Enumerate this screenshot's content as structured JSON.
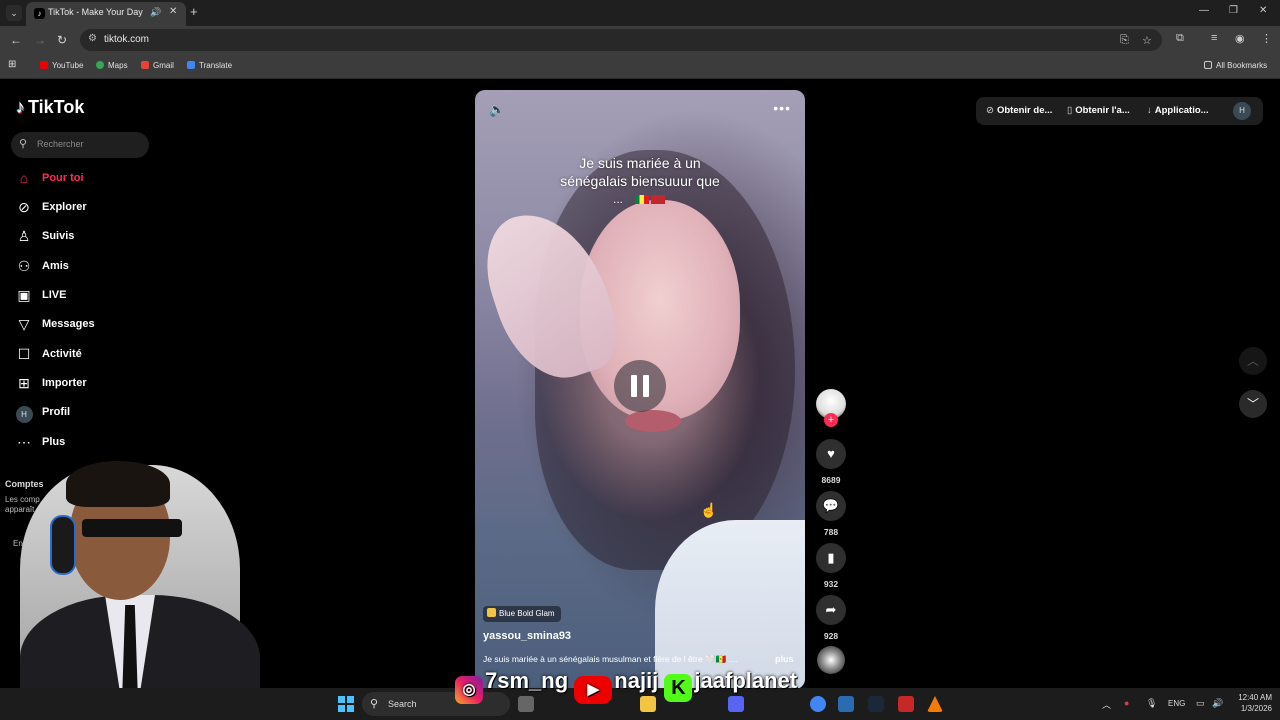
{
  "browser": {
    "tab_title": "TikTok - Make Your Day",
    "url": "tiktok.com",
    "bookmarks": [
      "YouTube",
      "Maps",
      "Gmail",
      "Translate"
    ],
    "all_bookmarks": "All Bookmarks"
  },
  "tiktok": {
    "logo": "TikTok",
    "search_placeholder": "Rechercher",
    "nav": [
      {
        "label": "Pour toi",
        "icon": "home-icon"
      },
      {
        "label": "Explorer",
        "icon": "compass-icon"
      },
      {
        "label": "Suivis",
        "icon": "following-icon"
      },
      {
        "label": "Amis",
        "icon": "friends-icon"
      },
      {
        "label": "LIVE",
        "icon": "live-icon"
      },
      {
        "label": "Messages",
        "icon": "messages-icon"
      },
      {
        "label": "Activité",
        "icon": "activity-icon"
      },
      {
        "label": "Importer",
        "icon": "upload-icon"
      },
      {
        "label": "Profil",
        "icon": "profile-avatar"
      },
      {
        "label": "Plus",
        "icon": "more-icon"
      }
    ],
    "profile_initial": "H",
    "side_partial": [
      "Comptes",
      "Les comp",
      "apparaît",
      "En"
    ]
  },
  "video": {
    "caption_line1": "Je suis mariée à un",
    "caption_line2": "sénégalais biensuuur que",
    "caption_line3": "...",
    "effect": "Blue Bold Glam",
    "author": "yassou_smina93",
    "description": "Je suis mariée à un sénégalais musulman et fière de l être 🤍🇸🇳 ....",
    "more": "plus",
    "counts": {
      "likes": "8689",
      "comments": "788",
      "saves": "932",
      "shares": "928"
    }
  },
  "topbar": {
    "item1": "Obtenir de...",
    "item2": "Obtenir l'a...",
    "item3": "Applicatio...",
    "avatar": "H"
  },
  "overlay": {
    "instagram": "7sm_ng",
    "youtube": "najij",
    "kick": "jaafplanet"
  },
  "taskbar": {
    "search": "Search",
    "lang": "ENG",
    "time": "12:40 AM",
    "date": "1/3/2026"
  }
}
